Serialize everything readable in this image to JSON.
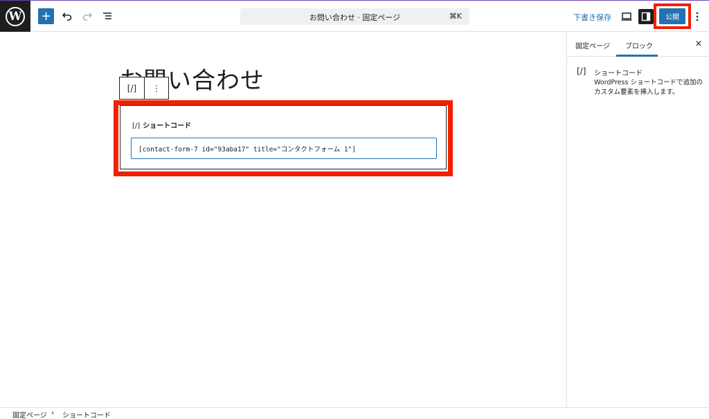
{
  "header": {
    "logo": "W",
    "add_label": "+",
    "doc_title": "お問い合わせ · 固定ページ",
    "doc_shortcut": "⌘K",
    "save_draft": "下書き保存",
    "publish": "公開"
  },
  "editor": {
    "post_title": "お問い合わせ",
    "block_toolbar": {
      "block_icon": "[/]",
      "options": "⋮"
    },
    "shortcode_block": {
      "icon": "[/]",
      "label": "ショートコード",
      "value": "[contact-form-7 id=\"93aba17\" title=\"コンタクトフォーム 1\"]"
    }
  },
  "sidebar": {
    "tabs": [
      {
        "label": "固定ページ"
      },
      {
        "label": "ブロック"
      }
    ],
    "close": "×",
    "block_icon": "[/]",
    "block_name": "ショートコード",
    "block_description": "WordPress ショートコードで追加のカスタム要素を挿入します。"
  },
  "breadcrumb": {
    "items": [
      "固定ページ",
      "ショートコード"
    ],
    "separator": "›"
  },
  "colors": {
    "accent": "#2271b1",
    "highlight": "#f02000",
    "dark": "#1e1e1e"
  }
}
